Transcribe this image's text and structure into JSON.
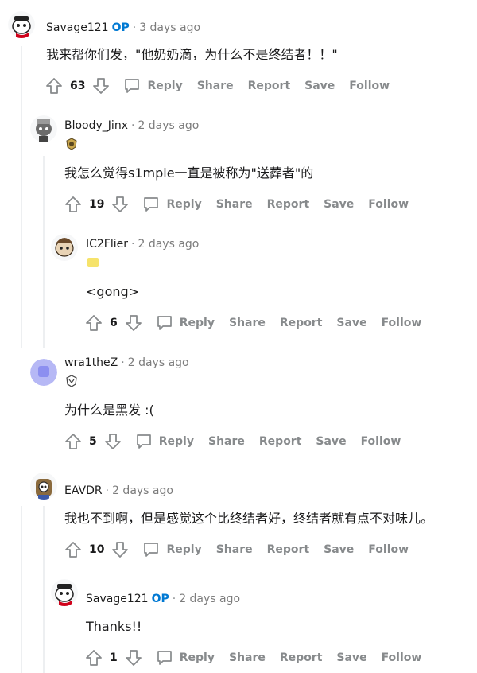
{
  "labels": {
    "reply": "Reply",
    "share": "Share",
    "report": "Report",
    "save": "Save",
    "follow": "Follow",
    "op": "OP",
    "dot": "·"
  },
  "comments": [
    {
      "author": "Savage121",
      "op": true,
      "time": "3 days ago",
      "text": "我来帮你们发，\"他奶奶滴，为什么不是终结者！！\"",
      "score": "63",
      "avatar_icon": "snoo-avatar-icon"
    },
    {
      "author": "Bloody_Jinx",
      "op": false,
      "time": "2 days ago",
      "flair_icon": "team-flair-icon",
      "text": "我怎么觉得s1mple一直是被称为\"送葬者\"的",
      "score": "19",
      "avatar_icon": "snoo-avatar-icon"
    },
    {
      "author": "IC2Flier",
      "op": false,
      "time": "2 days ago",
      "flair_icon": "yellow-flair-icon",
      "text": "<gong>",
      "score": "6",
      "avatar_icon": "snoo-avatar-icon"
    },
    {
      "author": "wra1theZ",
      "op": false,
      "time": "2 days ago",
      "flair_icon": "team-flair-icon",
      "text": "为什么是黑发 :(",
      "score": "5",
      "avatar_icon": "default-avatar-icon"
    },
    {
      "author": "EAVDR",
      "op": false,
      "time": "2 days ago",
      "text": "我也不到啊，但是感觉这个比终结者好，终结者就有点不对味儿。",
      "score": "10",
      "avatar_icon": "snoo-avatar-icon"
    },
    {
      "author": "Savage121",
      "op": true,
      "time": "2 days ago",
      "text": "Thanks!!",
      "score": "1",
      "avatar_icon": "snoo-avatar-icon"
    }
  ],
  "colors": {
    "op": "#0079d3",
    "meta": "#7c7c7c",
    "action": "#878a8c",
    "thread": "#edeff1"
  }
}
